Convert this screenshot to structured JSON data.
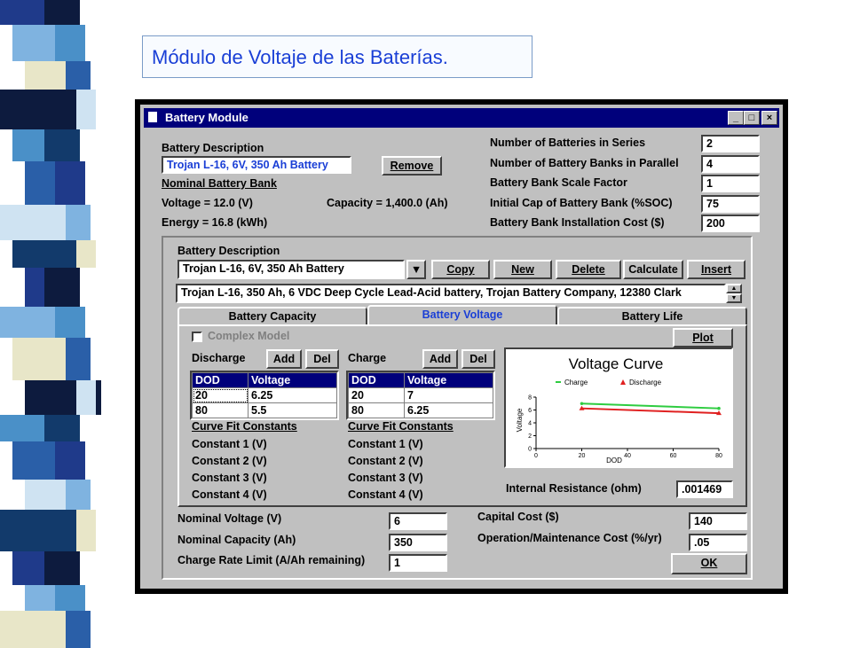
{
  "slide": {
    "title": "Módulo de Voltaje de las Baterías."
  },
  "window": {
    "title": "Battery Module",
    "controls": {
      "minimize": "_",
      "maximize": "□",
      "close": "×"
    }
  },
  "top": {
    "battery_description_label": "Battery Description",
    "battery_description_value": "Trojan L-16, 6V, 350 Ah Battery",
    "remove_button": "Remove",
    "nominal_bank_label": "Nominal Battery Bank",
    "voltage_text": "Voltage = 12.0 (V)",
    "capacity_text": "Capacity = 1,400.0 (Ah)",
    "energy_text": "Energy = 16.8 (kWh)",
    "params": [
      {
        "label": "Number of Batteries in Series",
        "value": "2"
      },
      {
        "label": "Number of Battery Banks in Parallel",
        "value": "4"
      },
      {
        "label": "Battery Bank Scale Factor",
        "value": "1"
      },
      {
        "label": "Initial Cap of Battery Bank (%SOC)",
        "value": "75"
      },
      {
        "label": "Battery Bank Installation Cost ($)",
        "value": "200"
      }
    ]
  },
  "group": {
    "label": "Battery Description",
    "combo_value": "Trojan L-16, 6V, 350 Ah Battery",
    "buttons": {
      "copy": "Copy",
      "new": "New",
      "delete": "Delete",
      "calculate": "Calculate",
      "insert": "Insert"
    },
    "description_line": "Trojan L-16, 350 Ah, 6 VDC Deep Cycle Lead-Acid battery, Trojan Battery Company, 12380 Clark"
  },
  "tabs": [
    {
      "label": "Battery Capacity"
    },
    {
      "label": "Battery Voltage"
    },
    {
      "label": "Battery Life"
    }
  ],
  "voltage_tab": {
    "complex_model_label": "Complex Model",
    "plot_button": "Plot",
    "discharge": {
      "label": "Discharge",
      "add": "Add",
      "del": "Del",
      "columns": [
        "DOD",
        "Voltage"
      ],
      "rows": [
        [
          "20",
          "6.25"
        ],
        [
          "80",
          "5.5"
        ]
      ]
    },
    "charge": {
      "label": "Charge",
      "add": "Add",
      "del": "Del",
      "columns": [
        "DOD",
        "Voltage"
      ],
      "rows": [
        [
          "20",
          "7"
        ],
        [
          "80",
          "6.25"
        ]
      ]
    },
    "curve_fit_label": "Curve Fit Constants",
    "constants": [
      "Constant 1 (V)",
      "Constant 2 (V)",
      "Constant 3 (V)",
      "Constant 4 (V)"
    ],
    "internal_resistance_label": "Internal Resistance (ohm)",
    "internal_resistance_value": ".001469"
  },
  "bottom": {
    "nominal_voltage_label": "Nominal Voltage (V)",
    "nominal_voltage_value": "6",
    "nominal_capacity_label": "Nominal Capacity (Ah)",
    "nominal_capacity_value": "350",
    "charge_rate_label": "Charge Rate Limit (A/Ah remaining)",
    "charge_rate_value": "1",
    "capital_cost_label": "Capital Cost ($)",
    "capital_cost_value": "140",
    "om_cost_label": "Operation/Maintenance Cost (%/yr)",
    "om_cost_value": ".05",
    "ok_button": "OK"
  },
  "chart_data": {
    "type": "line",
    "title": "Voltage Curve",
    "xlabel": "DOD",
    "ylabel": "Voltage",
    "xlim": [
      0,
      80
    ],
    "ylim": [
      0,
      8
    ],
    "xticks": [
      "0",
      "20",
      "40",
      "60",
      "80"
    ],
    "yticks": [
      "0",
      "2",
      "4",
      "6",
      "8"
    ],
    "legend_placement": "top",
    "series": [
      {
        "name": "Charge",
        "color": "#2ecc40",
        "x": [
          20,
          80
        ],
        "y": [
          7,
          6.25
        ]
      },
      {
        "name": "Discharge",
        "color": "#e02020",
        "x": [
          20,
          80
        ],
        "y": [
          6.25,
          5.5
        ]
      }
    ]
  }
}
